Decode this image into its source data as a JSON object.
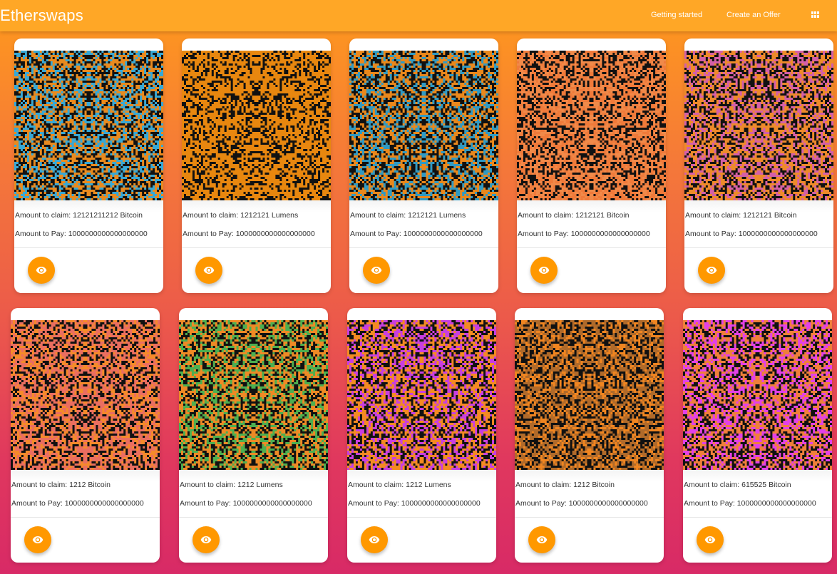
{
  "app": {
    "brand": "Etherswaps",
    "nav": {
      "getting_started": "Getting started",
      "create_offer": "Create an Offer"
    },
    "menu_icon": "grid-apps-icon"
  },
  "offers": [
    {
      "claim": "Amount to claim: 12121211212 Bitcoin",
      "pay": "Amount to Pay: 1000000000000000000",
      "colors": [
        "#36a8d6",
        "#e98a1e",
        "#111111"
      ]
    },
    {
      "claim": "Amount to claim: 1212121 Lumens",
      "pay": "Amount to Pay: 1000000000000000000",
      "colors": [
        "#e8870f",
        "#e8870f",
        "#111111"
      ]
    },
    {
      "claim": "Amount to claim: 1212121 Lumens",
      "pay": "Amount to Pay: 1000000000000000000",
      "colors": [
        "#2f9ac4",
        "#e9881c",
        "#111111"
      ]
    },
    {
      "claim": "Amount to claim: 1212121 Bitcoin",
      "pay": "Amount to Pay: 1000000000000000000",
      "colors": [
        "#f08a4a",
        "#f07a3a",
        "#111111"
      ]
    },
    {
      "claim": "Amount to claim: 1212121 Bitcoin",
      "pay": "Amount to Pay: 1000000000000000000",
      "colors": [
        "#d45fa8",
        "#ee8a2a",
        "#111111"
      ]
    },
    {
      "claim": "Amount to claim: 1212 Bitcoin",
      "pay": "Amount to Pay: 1000000000000000000",
      "colors": [
        "#f58a2a",
        "#ea6e60",
        "#111111"
      ]
    },
    {
      "claim": "Amount to claim: 1212 Lumens",
      "pay": "Amount to Pay: 1000000000000000000",
      "colors": [
        "#4caf50",
        "#ee8a25",
        "#111111"
      ]
    },
    {
      "claim": "Amount to claim: 1212 Lumens",
      "pay": "Amount to Pay: 1000000000000000000",
      "colors": [
        "#c83ee0",
        "#f48a22",
        "#111111"
      ]
    },
    {
      "claim": "Amount to claim: 1212 Bitcoin",
      "pay": "Amount to Pay: 1000000000000000000",
      "colors": [
        "#f08520",
        "#b06a2a",
        "#111111"
      ]
    },
    {
      "claim": "Amount to claim: 615525 Bitcoin",
      "pay": "Amount to Pay: 1000000000000000000",
      "colors": [
        "#e340e8",
        "#ef7f3a",
        "#111111"
      ]
    }
  ],
  "card_action": {
    "icon": "eye-icon"
  }
}
